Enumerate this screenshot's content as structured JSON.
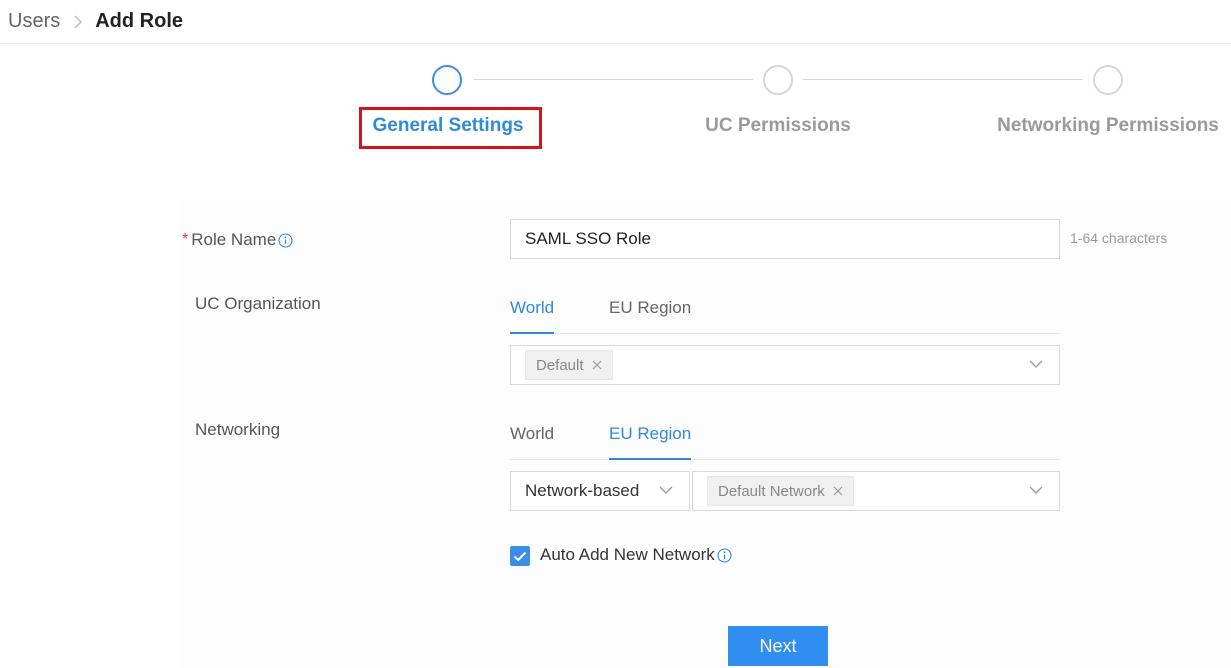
{
  "breadcrumb": {
    "parent": "Users",
    "current": "Add Role"
  },
  "steps": [
    {
      "label": "General Settings",
      "state": "active"
    },
    {
      "label": "UC Permissions",
      "state": "pending"
    },
    {
      "label": "Networking Permissions",
      "state": "pending"
    }
  ],
  "form": {
    "role_name": {
      "label": "Role Name",
      "value": "SAML SSO Role",
      "hint": "1-64 characters",
      "required": true
    },
    "uc_organization": {
      "label": "UC Organization",
      "tabs": [
        "World",
        "EU Region"
      ],
      "active_tab": "World",
      "selected_tags": [
        "Default"
      ]
    },
    "networking": {
      "label": "Networking",
      "tabs": [
        "World",
        "EU Region"
      ],
      "active_tab": "EU Region",
      "scope_select": "Network-based",
      "selected_tags": [
        "Default Network"
      ]
    },
    "auto_add": {
      "label": "Auto Add New Network",
      "checked": true
    }
  },
  "actions": {
    "next_label": "Next"
  },
  "colors": {
    "accent": "#2f8ad8",
    "button": "#2f8ef0",
    "highlight": "#d8121d",
    "required": "#e63e3e"
  }
}
